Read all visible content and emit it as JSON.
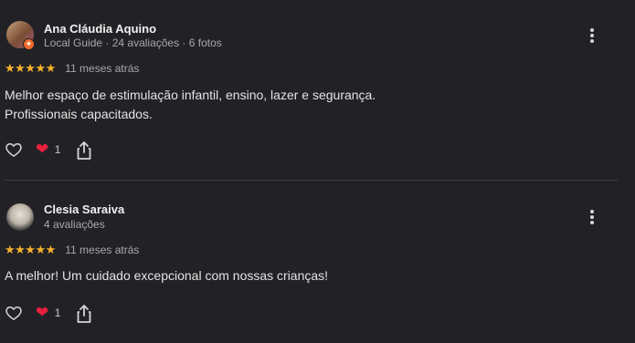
{
  "reviews": [
    {
      "name": "Ana Cláudia Aquino",
      "meta": "Local Guide · 24 avaliações · 6 fotos",
      "stars": "★★★★★",
      "rating": 5,
      "date": "11 meses atrás",
      "text_lines": [
        "Melhor espaço de estimulação infantil, ensino, lazer e segurança.",
        "Profissionais capacitados."
      ],
      "reaction_count": "1",
      "icons": {
        "more": "more-vert-icon",
        "like": "heart-outline-icon",
        "reaction": "heart-filled-icon",
        "share": "share-icon",
        "badge": "local-guide-badge-icon"
      }
    },
    {
      "name": "Clesia Saraiva",
      "meta": "4 avaliações",
      "stars": "★★★★★",
      "rating": 5,
      "date": "11 meses atrás",
      "text_lines": [
        "A melhor! Um cuidado excepcional com nossas crianças!"
      ],
      "reaction_count": "1",
      "icons": {
        "more": "more-vert-icon",
        "like": "heart-outline-icon",
        "reaction": "heart-filled-icon",
        "share": "share-icon"
      }
    }
  ],
  "colors": {
    "background": "#222226",
    "star": "#f7b32b",
    "heart": "#e8213e",
    "badge": "#f06b2a",
    "muted_text": "#a8a8ad"
  }
}
